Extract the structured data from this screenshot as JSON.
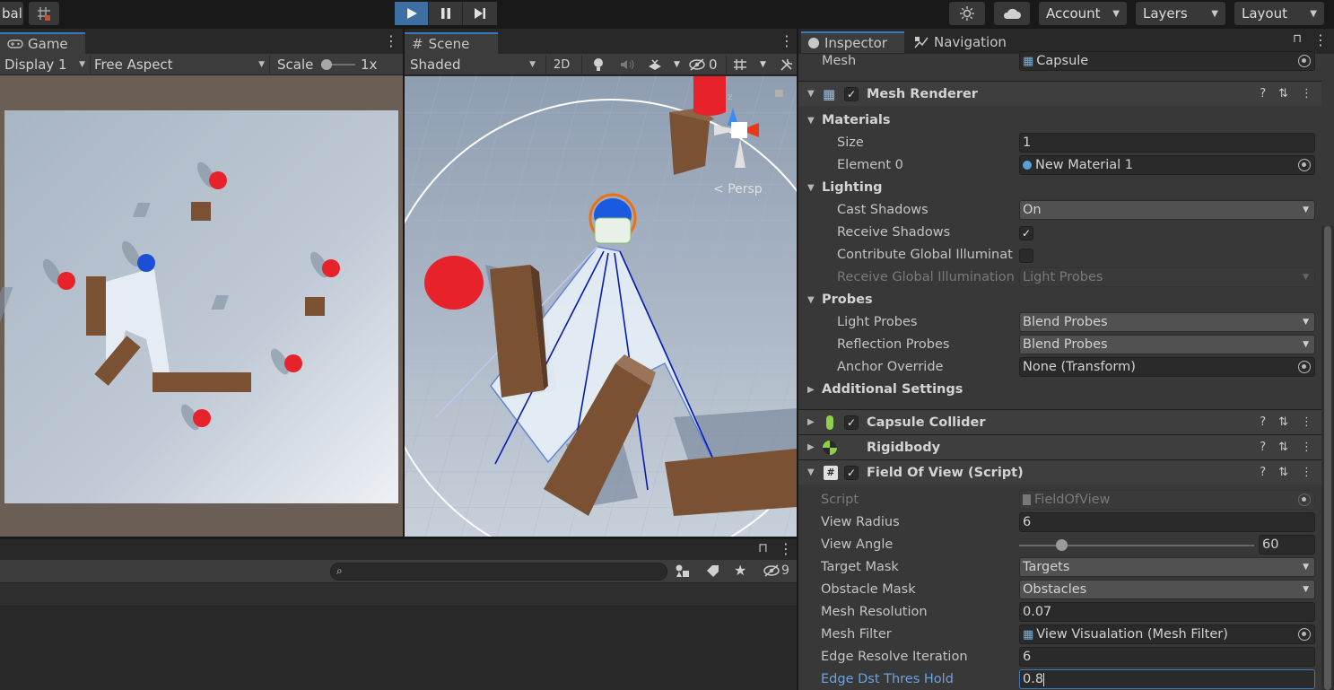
{
  "toolbar": {
    "global_label": "bal",
    "account_label": "Account",
    "layers_label": "Layers",
    "layout_label": "Layout"
  },
  "game": {
    "tab_label": "Game",
    "display_label": "Display 1",
    "aspect_label": "Free Aspect",
    "scale_label": "Scale",
    "scale_value": "1x"
  },
  "scene": {
    "tab_label": "Scene",
    "shading_label": "Shaded",
    "mode_2d": "2D",
    "hidden_count": "0",
    "persp_label": "Persp",
    "gizmo_axis_label": "z"
  },
  "console": {
    "search_placeholder": "",
    "hidden_count": "9"
  },
  "inspector": {
    "tabs": [
      "Inspector",
      "Navigation"
    ],
    "mesh_label": "Mesh",
    "mesh_value": "Capsule",
    "mesh_renderer": {
      "title": "Mesh Renderer",
      "materials_header": "Materials",
      "size_label": "Size",
      "size_value": "1",
      "element0_label": "Element 0",
      "element0_value": "New Material 1",
      "lighting_header": "Lighting",
      "cast_shadows_label": "Cast Shadows",
      "cast_shadows_value": "On",
      "receive_shadows_label": "Receive Shadows",
      "contribute_gi_label": "Contribute Global Illuminatic",
      "receive_gi_label": "Receive Global Illumination",
      "receive_gi_value": "Light Probes",
      "probes_header": "Probes",
      "light_probes_label": "Light Probes",
      "light_probes_value": "Blend Probes",
      "reflection_probes_label": "Reflection Probes",
      "reflection_probes_value": "Blend Probes",
      "anchor_override_label": "Anchor Override",
      "anchor_override_value": "None (Transform)",
      "additional_settings": "Additional Settings"
    },
    "capsule_collider": "Capsule Collider",
    "rigidbody": "Rigidbody",
    "fov": {
      "title": "Field Of View (Script)",
      "script_label": "Script",
      "script_value": "FieldOfView",
      "view_radius_label": "View Radius",
      "view_radius_value": "6",
      "view_angle_label": "View Angle",
      "view_angle_value": "60",
      "view_angle_slider_fraction": 0.18,
      "target_mask_label": "Target Mask",
      "target_mask_value": "Targets",
      "obstacle_mask_label": "Obstacle Mask",
      "obstacle_mask_value": "Obstacles",
      "mesh_resolution_label": "Mesh Resolution",
      "mesh_resolution_value": "0.07",
      "mesh_filter_label": "Mesh Filter",
      "mesh_filter_value": "View Visualation (Mesh Filter)",
      "edge_resolve_label": "Edge Resolve Iteration",
      "edge_resolve_value": "6",
      "edge_dst_label": "Edge Dst Thres Hold",
      "edge_dst_value": "0.8"
    }
  },
  "colors": {
    "accent": "#3a79bb",
    "play_active": "#3d6fa3",
    "enemy": "#e8222b",
    "player": "#1b4fd6",
    "wall": "#7a5233"
  }
}
